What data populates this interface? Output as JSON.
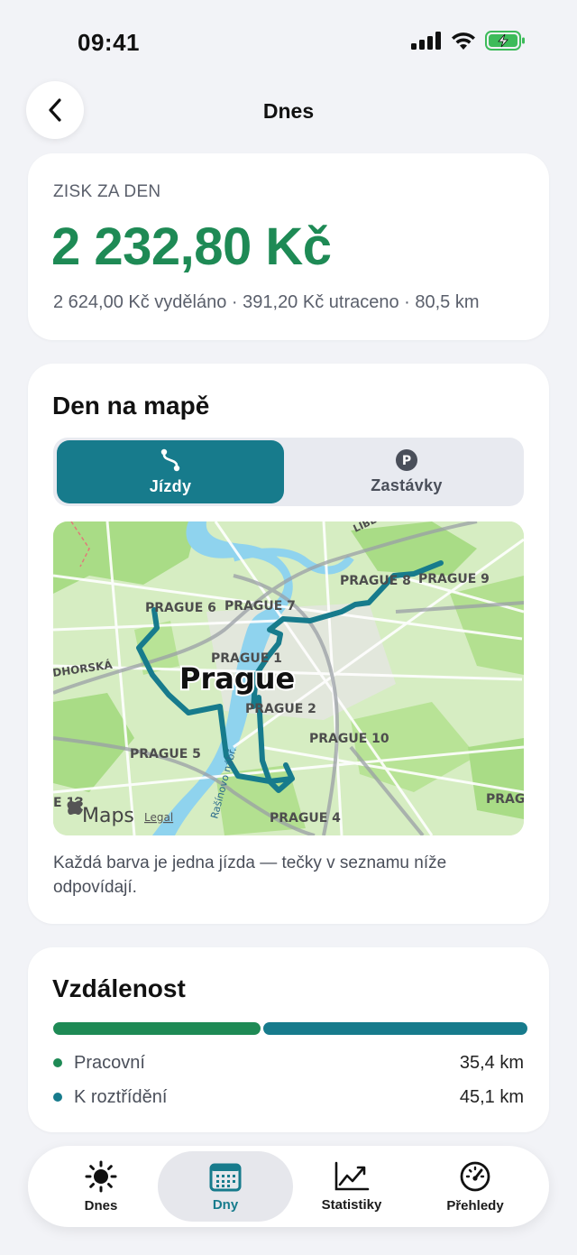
{
  "status_bar": {
    "time": "09:41"
  },
  "header": {
    "title": "Dnes"
  },
  "profit": {
    "label": "ZISK ZA DEN",
    "value": "2 232,80 Kč",
    "summary": "2 624,00 Kč vyděláno · 391,20 Kč utraceno · 80,5 km"
  },
  "map_card": {
    "title": "Den na mapě",
    "segments": [
      {
        "label": "Jízdy",
        "icon": "route-icon",
        "selected": true
      },
      {
        "label": "Zastávky",
        "icon": "parking-icon",
        "selected": false
      }
    ],
    "map": {
      "city_label": "Prague",
      "district_labels": [
        "PRAGUE 1",
        "PRAGUE 2",
        "PRAGUE 4",
        "PRAGUE 5",
        "PRAGUE 6",
        "PRAGUE 7",
        "PRAGUE 8",
        "PRAGUE 9",
        "PRAGUE 10",
        "PRAGU",
        "E 13"
      ],
      "street_labels": [
        "LIBE",
        "DHORSKÁ",
        "Rašínovo nábř."
      ],
      "attribution": "Maps",
      "legal": "Legal",
      "route_color": "#177b8c"
    },
    "caption": "Každá barva je jedna jízda — tečky v seznamu níže odpovídají."
  },
  "distance": {
    "title": "Vzdálenost",
    "items": [
      {
        "label": "Pracovní",
        "value": "35,4 km",
        "km": 35.4,
        "color": "#1e8a55"
      },
      {
        "label": "K roztřídění",
        "value": "45,1 km",
        "km": 45.1,
        "color": "#177b8c"
      }
    ]
  },
  "tabbar": {
    "tabs": [
      {
        "label": "Dnes",
        "icon": "sun-icon",
        "active": false
      },
      {
        "label": "Dny",
        "icon": "calendar-icon",
        "active": true
      },
      {
        "label": "Statistiky",
        "icon": "chart-icon",
        "active": false
      },
      {
        "label": "Přehledy",
        "icon": "gauge-icon",
        "active": false
      }
    ]
  }
}
